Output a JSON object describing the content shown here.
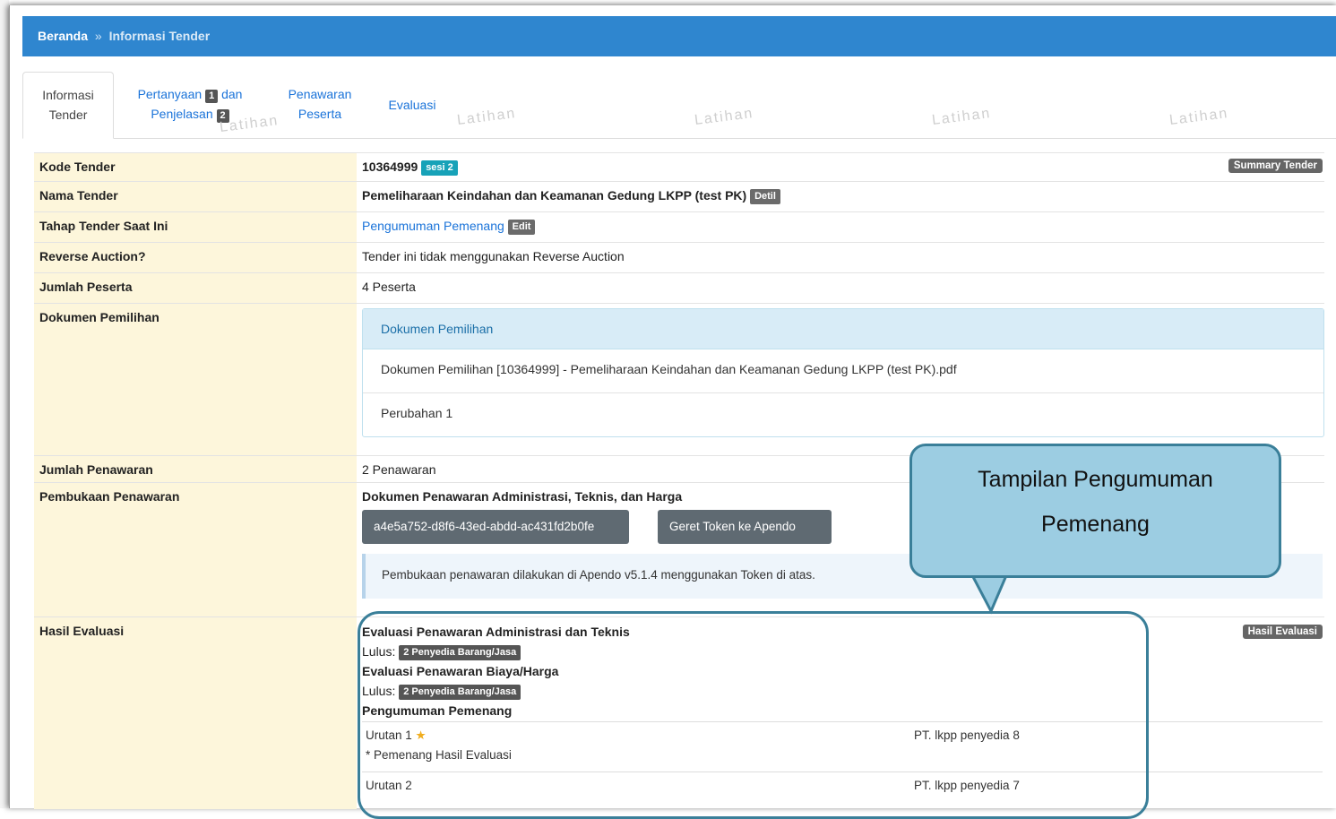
{
  "breadcrumb": {
    "home": "Beranda",
    "separator": "»",
    "current": "Informasi Tender"
  },
  "tabs": [
    {
      "line1": "Informasi",
      "line2": "Tender"
    },
    {
      "line1": "Pertanyaan",
      "badge1": "1",
      "line1b": "dan",
      "line2": "Penjelasan",
      "badge2": "2"
    },
    {
      "line1": "Penawaran",
      "line2": "Peserta"
    },
    {
      "line1": "Evaluasi"
    }
  ],
  "watermark_text": "Latihan",
  "rows": {
    "kode": {
      "label": "Kode Tender",
      "value": "10364999",
      "badge": "sesi 2",
      "button": "Summary Tender"
    },
    "nama": {
      "label": "Nama Tender",
      "value": "Pemeliharaan Keindahan dan Keamanan Gedung LKPP (test PK)",
      "badge": "Detil"
    },
    "tahap": {
      "label": "Tahap Tender Saat Ini",
      "value": "Pengumuman Pemenang",
      "badge": "Edit"
    },
    "reverse": {
      "label": "Reverse Auction?",
      "value": "Tender ini tidak menggunakan Reverse Auction"
    },
    "peserta": {
      "label": "Jumlah Peserta",
      "value": "4 Peserta"
    },
    "dokumen": {
      "label": "Dokumen Pemilihan",
      "panel_title": "Dokumen Pemilihan",
      "items": [
        "Dokumen Pemilihan [10364999] - Pemeliharaan Keindahan dan Keamanan Gedung LKPP (test PK).pdf",
        "Perubahan 1"
      ]
    },
    "penawaran": {
      "label": "Jumlah Penawaran",
      "value": "2 Penawaran"
    },
    "pembukaan": {
      "label": "Pembukaan Penawaran",
      "title": "Dokumen Penawaran Administrasi, Teknis, dan Harga",
      "token": "a4e5a752-d8f6-43ed-abdd-ac431fd2b0fe",
      "send_button": "Geret Token ke Apendo",
      "info": "Pembukaan penawaran dilakukan di Apendo v5.1.4 menggunakan Token di atas."
    },
    "hasil": {
      "label": "Hasil Evaluasi",
      "button": "Hasil Evaluasi",
      "admin_title": "Evaluasi Penawaran Administrasi dan Teknis",
      "lulus_label": "Lulus:",
      "admin_badge": "2 Penyedia Barang/Jasa",
      "biaya_title": "Evaluasi Penawaran Biaya/Harga",
      "biaya_badge": "2 Penyedia Barang/Jasa",
      "pengumuman_title": "Pengumuman Pemenang",
      "ranks": [
        {
          "urutan": "Urutan 1",
          "star": "★",
          "note": "* Pemenang Hasil Evaluasi",
          "penyedia": "PT. lkpp penyedia 8"
        },
        {
          "urutan": "Urutan 2",
          "penyedia": "PT. lkpp penyedia 7"
        }
      ]
    }
  },
  "callout": {
    "line1": "Tampilan Pengumuman",
    "line2": "Pemenang"
  },
  "colors": {
    "topbar": "#2f86cf",
    "label_bg": "#fdf6db",
    "callout_bg": "#9ccde2",
    "callout_border": "#3a7f99"
  }
}
